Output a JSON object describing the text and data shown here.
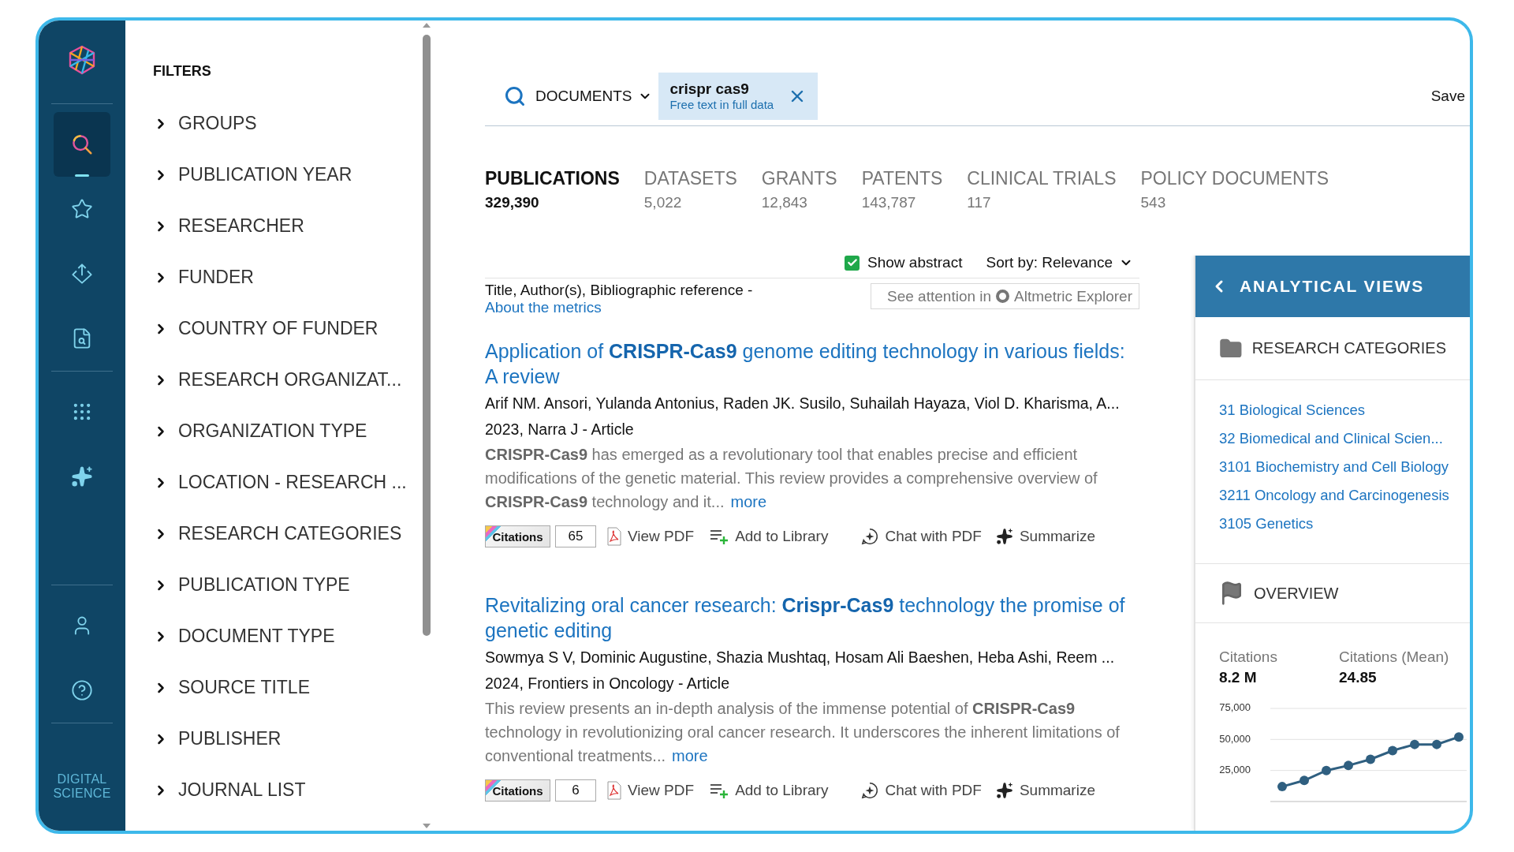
{
  "sidebar": {
    "nav_groups": [
      [
        {
          "kind": "search",
          "selected": true
        },
        {
          "kind": "star",
          "selected": false
        },
        {
          "kind": "export",
          "selected": false
        },
        {
          "kind": "document-search",
          "selected": false
        }
      ],
      [
        {
          "kind": "apps",
          "selected": false
        },
        {
          "kind": "sparkle",
          "selected": false
        }
      ],
      [
        {
          "kind": "user",
          "selected": false
        },
        {
          "kind": "help",
          "selected": false
        }
      ]
    ],
    "brand": "DIGITAL SCIENCE"
  },
  "filters": {
    "title": "FILTERS",
    "items": [
      {
        "label": "GROUPS",
        "expanded": false
      },
      {
        "label": "PUBLICATION YEAR",
        "expanded": false
      },
      {
        "label": "RESEARCHER",
        "expanded": false
      },
      {
        "label": "FUNDER",
        "expanded": false
      },
      {
        "label": "COUNTRY OF FUNDER",
        "expanded": false
      },
      {
        "label": "RESEARCH ORGANIZAT...",
        "expanded": false
      },
      {
        "label": "ORGANIZATION TYPE",
        "expanded": false
      },
      {
        "label": "LOCATION - RESEARCH ...",
        "expanded": false
      },
      {
        "label": "RESEARCH CATEGORIES",
        "expanded": false
      },
      {
        "label": "PUBLICATION TYPE",
        "expanded": false
      },
      {
        "label": "DOCUMENT TYPE",
        "expanded": false
      },
      {
        "label": "SOURCE TITLE",
        "expanded": false
      },
      {
        "label": "PUBLISHER",
        "expanded": false
      },
      {
        "label": "JOURNAL LIST",
        "expanded": false
      }
    ]
  },
  "search": {
    "scope": "DOCUMENTS",
    "query": "crispr cas9",
    "query_hint": "Free text in full data",
    "save": "Save"
  },
  "tabs": [
    {
      "label": "PUBLICATIONS",
      "count": "329,390",
      "selected": true
    },
    {
      "label": "DATASETS",
      "count": "5,022",
      "selected": false
    },
    {
      "label": "GRANTS",
      "count": "12,843",
      "selected": false
    },
    {
      "label": "PATENTS",
      "count": "143,787",
      "selected": false
    },
    {
      "label": "CLINICAL TRIALS",
      "count": "117",
      "selected": false
    },
    {
      "label": "POLICY DOCUMENTS",
      "count": "543",
      "selected": false
    }
  ],
  "toolbar": {
    "show_abstract": {
      "label": "Show abstract",
      "checked": true
    },
    "sort_label": "Sort by:",
    "sort_value": "Relevance",
    "columns_label": "Title, Author(s), Bibliographic reference -",
    "metrics_link": "About the metrics",
    "attention_prefix": "See attention in",
    "attention_target": "Altmetric Explorer"
  },
  "results": [
    {
      "title": "Application of **CRISPR-Cas9** genome editing technology in various fields: A review",
      "authors": "Arif NM. Ansori, Yulanda Antonius, Raden JK. Susilo, Suhailah Hayaza, Viol D. Kharisma, A...",
      "meta": "2023, Narra J - Article",
      "abstract": "**CRISPR-Cas9** has emerged as a revolutionary tool that enables precise and efficient modifications of the genetic material. This review provides a comprehensive overview of **CRISPR-Cas9** technology and it...",
      "more": "more",
      "citations_label": "Citations",
      "citations": "65",
      "actions": [
        {
          "kind": "pdf",
          "label": "View PDF"
        },
        {
          "kind": "library",
          "label": "Add to Library"
        },
        {
          "kind": "chat",
          "label": "Chat with PDF"
        },
        {
          "kind": "summarize",
          "label": "Summarize"
        }
      ]
    },
    {
      "title": "Revitalizing oral cancer research: **Crispr-Cas9** technology the promise of genetic editing",
      "authors": "Sowmya S V, Dominic Augustine, Shazia Mushtaq, Hosam Ali Baeshen, Heba Ashi, Reem ...",
      "meta": "2024, Frontiers in Oncology - Article",
      "abstract": "This review presents an in-depth analysis of the immense potential of **CRISPR-Cas9** technology in revolutionizing oral cancer research. It underscores the inherent limitations of conventional treatments...",
      "more": "more",
      "citations_label": "Citations",
      "citations": "6",
      "actions": [
        {
          "kind": "pdf",
          "label": "View PDF"
        },
        {
          "kind": "library",
          "label": "Add to Library"
        },
        {
          "kind": "chat",
          "label": "Chat with PDF"
        },
        {
          "kind": "summarize",
          "label": "Summarize"
        }
      ]
    }
  ],
  "analytical_views": {
    "title": "ANALYTICAL VIEWS",
    "categories": {
      "title": "RESEARCH CATEGORIES",
      "items": [
        "31 Biological Sciences",
        "32 Biomedical and Clinical Scien...",
        "3101 Biochemistry and Cell Biology",
        "3211 Oncology and Carcinogenesis",
        "3105 Genetics"
      ]
    },
    "overview": {
      "title": "OVERVIEW",
      "stats": [
        {
          "label": "Citations",
          "value": "8.2 M"
        },
        {
          "label": "Citations (Mean)",
          "value": "24.85"
        }
      ],
      "chart_data": {
        "type": "line",
        "ylim": [
          0,
          75000
        ],
        "yticks": [
          {
            "value": 25000,
            "label": "25,000"
          },
          {
            "value": 50000,
            "label": "50,000"
          },
          {
            "value": 75000,
            "label": "75,000"
          }
        ],
        "series": [
          {
            "marker": true,
            "color": "#2f5f80",
            "values": [
              12000,
              17000,
              25000,
              29000,
              34000,
              41000,
              46000,
              46000,
              52000
            ]
          }
        ]
      }
    }
  }
}
